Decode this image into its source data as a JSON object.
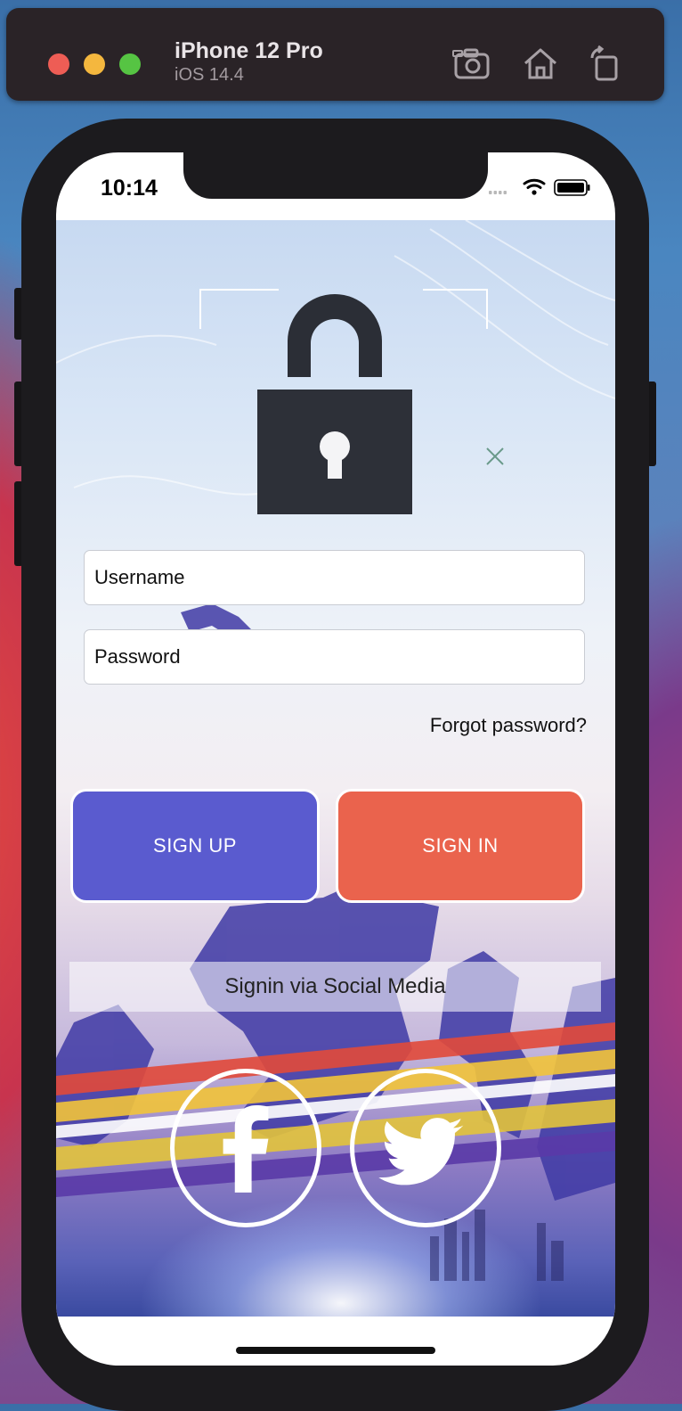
{
  "simulator": {
    "device_name": "iPhone 12 Pro",
    "os_version": "iOS 14.4",
    "tools": [
      "screenshot-icon",
      "home-icon",
      "rotate-icon"
    ]
  },
  "status_bar": {
    "time": "10:14",
    "icons": [
      "signal-icon",
      "wifi-icon",
      "battery-icon"
    ]
  },
  "login": {
    "username_placeholder": "Username",
    "password_placeholder": "Password",
    "forgot_password": "Forgot password?",
    "sign_up": "SIGN UP",
    "sign_in": "SIGN IN",
    "social_heading": "Signin via Social Media",
    "social_buttons": [
      "facebook-icon",
      "twitter-icon"
    ]
  },
  "colors": {
    "sign_up_bg": "#5a5bcf",
    "sign_in_bg": "#ea634d"
  }
}
